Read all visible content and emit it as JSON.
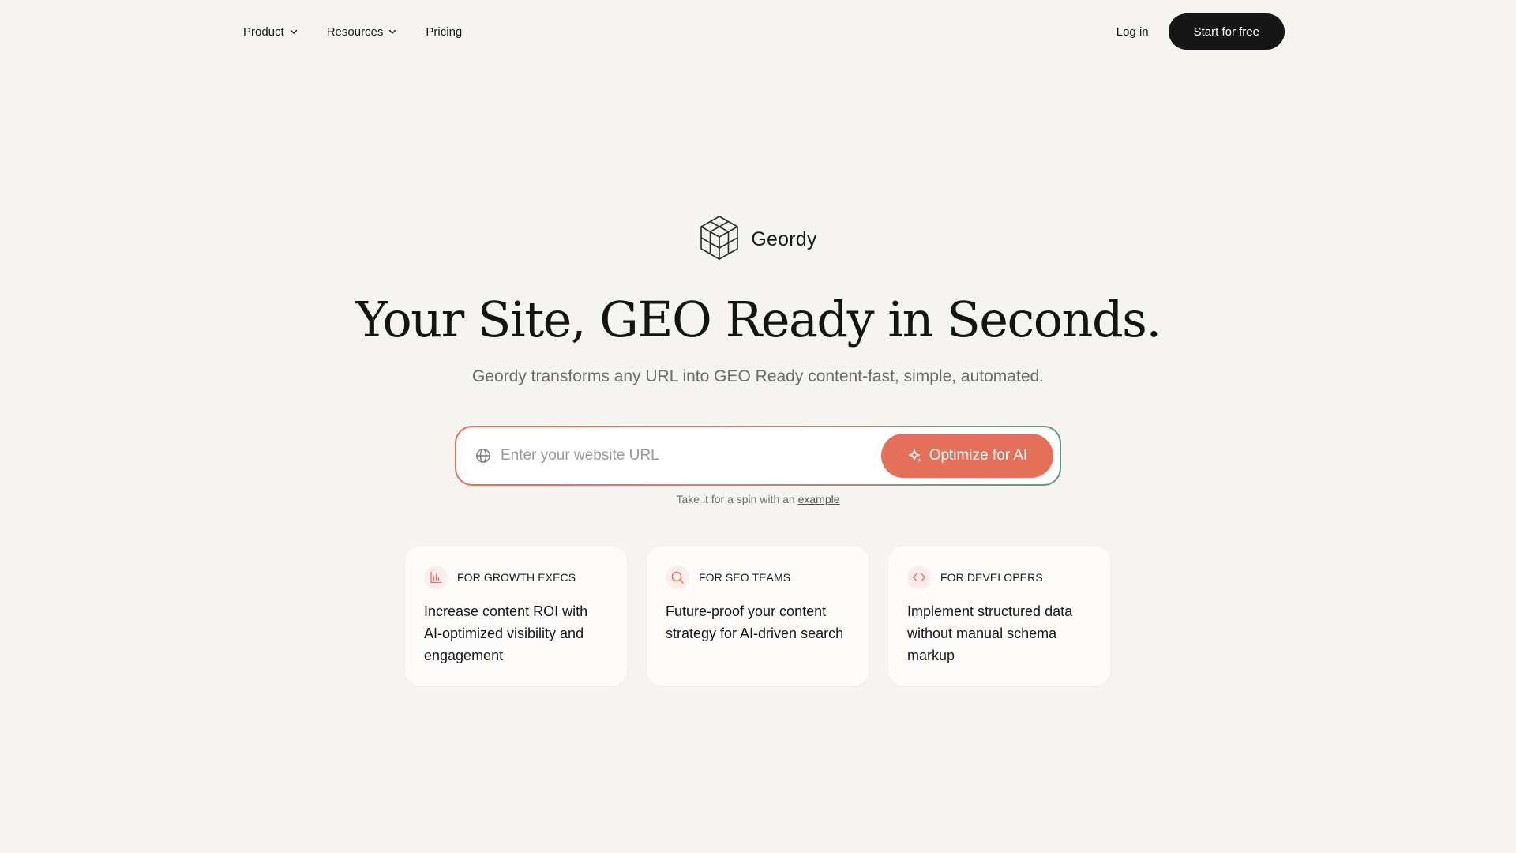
{
  "nav": {
    "items": [
      {
        "label": "Product",
        "has_dropdown": true
      },
      {
        "label": "Resources",
        "has_dropdown": true
      },
      {
        "label": "Pricing",
        "has_dropdown": false
      }
    ],
    "login_label": "Log in",
    "start_label": "Start for free"
  },
  "brand": {
    "name": "Geordy",
    "logo_icon": "hexagon-cube-logo-icon"
  },
  "hero": {
    "headline": "Your Site, GEO Ready in Seconds.",
    "subhead": "Geordy transforms any URL into GEO Ready content-fast, simple, automated."
  },
  "url_form": {
    "placeholder": "Enter your website URL",
    "value": "",
    "button_label": "Optimize for AI",
    "hint_prefix": "Take it for a spin with an",
    "hint_link": "example"
  },
  "cards": [
    {
      "tag": "FOR GROWTH EXECS",
      "icon": "bar-chart-icon",
      "text": "Increase content ROI with AI-optimized visibility and engagement"
    },
    {
      "tag": "FOR SEO TEAMS",
      "icon": "search-icon",
      "text": "Future-proof your content strategy for AI-driven search"
    },
    {
      "tag": "FOR DEVELOPERS",
      "icon": "code-icon",
      "text": "Implement structured data without manual schema markup"
    }
  ],
  "colors": {
    "background": "#f5f4f1",
    "accent": "#e4705a",
    "dark_button": "#161616",
    "gradient_end": "#5f9a88"
  }
}
